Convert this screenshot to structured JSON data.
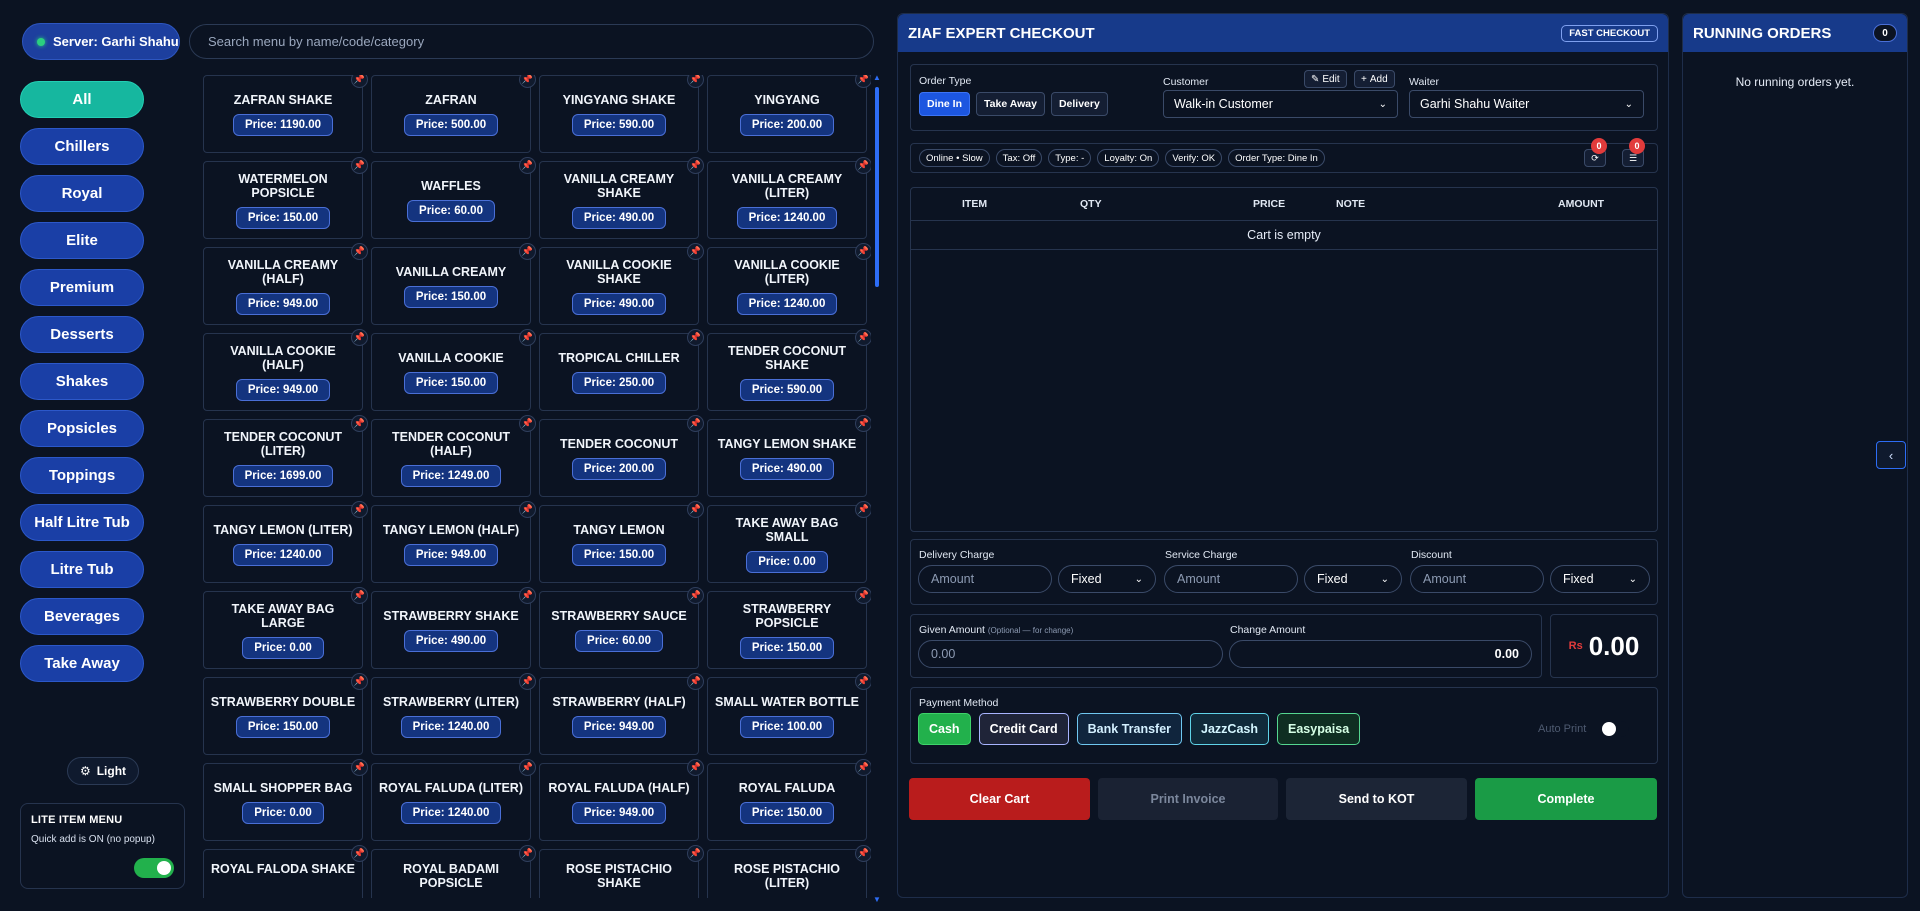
{
  "server": {
    "label": "Server: Garhi Shahu"
  },
  "search": {
    "placeholder": "Search menu by name/code/category"
  },
  "categories": [
    "All",
    "Chillers",
    "Royal",
    "Elite",
    "Premium",
    "Desserts",
    "Shakes",
    "Popsicles",
    "Toppings",
    "Half Litre Tub",
    "Litre Tub",
    "Beverages",
    "Take Away"
  ],
  "theme_toggle": {
    "label": "Light"
  },
  "lite_menu": {
    "title": "LITE ITEM MENU",
    "subtitle": "Quick add is ON (no popup)"
  },
  "menu_items": [
    {
      "name": "ZAFRAN SHAKE",
      "price": "Price: 1190.00"
    },
    {
      "name": "ZAFRAN",
      "price": "Price: 500.00"
    },
    {
      "name": "YINGYANG SHAKE",
      "price": "Price: 590.00"
    },
    {
      "name": "YINGYANG",
      "price": "Price: 200.00"
    },
    {
      "name": "WATERMELON POPSICLE",
      "price": "Price: 150.00"
    },
    {
      "name": "WAFFLES",
      "price": "Price: 60.00"
    },
    {
      "name": "VANILLA CREAMY SHAKE",
      "price": "Price: 490.00"
    },
    {
      "name": "VANILLA CREAMY (LITER)",
      "price": "Price: 1240.00"
    },
    {
      "name": "VANILLA CREAMY (HALF)",
      "price": "Price: 949.00"
    },
    {
      "name": "VANILLA CREAMY",
      "price": "Price: 150.00"
    },
    {
      "name": "VANILLA COOKIE SHAKE",
      "price": "Price: 490.00"
    },
    {
      "name": "VANILLA COOKIE (LITER)",
      "price": "Price: 1240.00"
    },
    {
      "name": "VANILLA COOKIE (HALF)",
      "price": "Price: 949.00"
    },
    {
      "name": "VANILLA COOKIE",
      "price": "Price: 150.00"
    },
    {
      "name": "TROPICAL CHILLER",
      "price": "Price: 250.00"
    },
    {
      "name": "TENDER COCONUT SHAKE",
      "price": "Price: 590.00"
    },
    {
      "name": "TENDER COCONUT (LITER)",
      "price": "Price: 1699.00"
    },
    {
      "name": "TENDER COCONUT (HALF)",
      "price": "Price: 1249.00"
    },
    {
      "name": "TENDER COCONUT",
      "price": "Price: 200.00"
    },
    {
      "name": "TANGY LEMON SHAKE",
      "price": "Price: 490.00"
    },
    {
      "name": "TANGY LEMON (LITER)",
      "price": "Price: 1240.00"
    },
    {
      "name": "TANGY LEMON (HALF)",
      "price": "Price: 949.00"
    },
    {
      "name": "TANGY LEMON",
      "price": "Price: 150.00"
    },
    {
      "name": "TAKE AWAY BAG SMALL",
      "price": "Price: 0.00"
    },
    {
      "name": "TAKE AWAY BAG LARGE",
      "price": "Price: 0.00"
    },
    {
      "name": "STRAWBERRY SHAKE",
      "price": "Price: 490.00"
    },
    {
      "name": "STRAWBERRY SAUCE",
      "price": "Price: 60.00"
    },
    {
      "name": "STRAWBERRY POPSICLE",
      "price": "Price: 150.00"
    },
    {
      "name": "STRAWBERRY DOUBLE",
      "price": "Price: 150.00"
    },
    {
      "name": "STRAWBERRY (LITER)",
      "price": "Price: 1240.00"
    },
    {
      "name": "STRAWBERRY (HALF)",
      "price": "Price: 949.00"
    },
    {
      "name": "SMALL WATER BOTTLE",
      "price": "Price: 100.00"
    },
    {
      "name": "SMALL SHOPPER BAG",
      "price": "Price: 0.00"
    },
    {
      "name": "ROYAL FALUDA (LITER)",
      "price": "Price: 1240.00"
    },
    {
      "name": "ROYAL FALUDA (HALF)",
      "price": "Price: 949.00"
    },
    {
      "name": "ROYAL FALUDA",
      "price": "Price: 150.00"
    },
    {
      "name": "ROYAL FALODA SHAKE",
      "price": ""
    },
    {
      "name": "ROYAL BADAMI POPSICLE",
      "price": ""
    },
    {
      "name": "ROSE PISTACHIO SHAKE",
      "price": ""
    },
    {
      "name": "ROSE PISTACHIO (LITER)",
      "price": ""
    }
  ],
  "checkout": {
    "title": "ZIAF EXPERT CHECKOUT",
    "fast_badge": "FAST CHECKOUT",
    "order_type_label": "Order Type",
    "order_types": [
      "Dine In",
      "Take Away",
      "Delivery"
    ],
    "customer_label": "Customer",
    "edit_label": "Edit",
    "add_label": "Add",
    "customer_value": "Walk-in Customer",
    "waiter_label": "Waiter",
    "waiter_value": "Garhi Shahu Waiter",
    "chips": [
      "Online • Slow",
      "Tax: Off",
      "Type: -",
      "Loyalty: On",
      "Verify: OK",
      "Order Type: Dine In"
    ],
    "sync_badge": "0",
    "queue_badge": "0",
    "table_headers": {
      "item": "ITEM",
      "qty": "QTY",
      "price": "PRICE",
      "note": "NOTE",
      "amount": "AMOUNT"
    },
    "cart_empty": "Cart is empty",
    "delivery_charge_label": "Delivery Charge",
    "service_charge_label": "Service Charge",
    "discount_label": "Discount",
    "amount_placeholder": "Amount",
    "fixed_label": "Fixed",
    "given_amount_label": "Given Amount",
    "given_amount_hint": "(Optional — for change)",
    "given_amount_placeholder": "0.00",
    "change_amount_label": "Change Amount",
    "change_amount_value": "0.00",
    "total_currency": "Rs",
    "total_value": "0.00",
    "payment_method_label": "Payment Method",
    "payment_methods": [
      "Cash",
      "Credit Card",
      "Bank Transfer",
      "JazzCash",
      "Easypaisa"
    ],
    "auto_print_label": "Auto Print",
    "actions": {
      "clear": "Clear Cart",
      "print": "Print Invoice",
      "kot": "Send to KOT",
      "complete": "Complete"
    }
  },
  "running_orders": {
    "title": "RUNNING ORDERS",
    "count": "0",
    "empty": "No running orders yet."
  },
  "colors": {
    "accent": "#1c56e0",
    "teal": "#16b79f",
    "danger": "#b91c1c",
    "success": "#1a9b46"
  }
}
